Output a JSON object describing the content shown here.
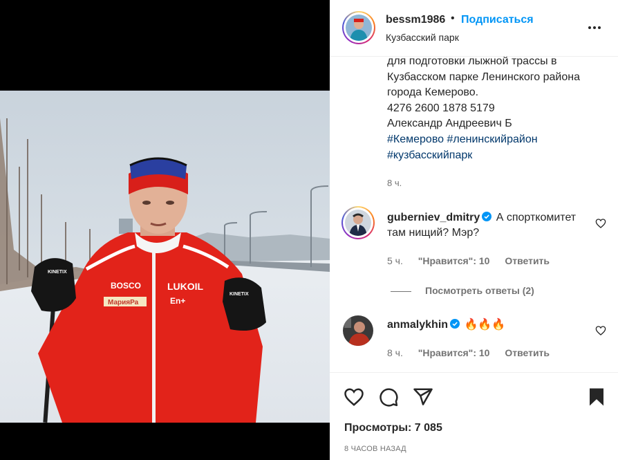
{
  "post": {
    "username": "bessm1986",
    "separator": "•",
    "follow_label": "Подписаться",
    "location": "Кузбасский парк",
    "more_icon": "more-horizontal-icon"
  },
  "caption": {
    "lines": [
      "для подготовки лыжной трассы в",
      "Кузбасском парке Ленинского района",
      "города Кемерово.",
      "4276 2600 1878 5179",
      "Александр Андреевич Б"
    ],
    "hashtags_line1": [
      "#Кемерово",
      "#ленинскийрайон"
    ],
    "hashtags_line2": [
      "#кузбасскийпарк"
    ],
    "time": "8 ч."
  },
  "comments": [
    {
      "username": "guberniev_dmitry",
      "verified": true,
      "text": "А спорткомитет там нищий? Мэр?",
      "time": "5 ч.",
      "likes": "\"Нравится\": 10",
      "reply": "Ответить",
      "view_replies": "Посмотреть ответы (2)"
    },
    {
      "username": "anmalykhin",
      "verified": true,
      "text": "🔥🔥🔥",
      "time": "8 ч.",
      "likes": "\"Нравится\": 10",
      "reply": "Ответить"
    }
  ],
  "actions": {
    "like_icon": "heart-icon",
    "comment_icon": "comment-icon",
    "share_icon": "share-icon",
    "save_icon": "bookmark-icon"
  },
  "stats": {
    "views_label": "Просмотры:",
    "views_value": "7 085",
    "time_ago": "8 ЧАСОВ НАЗАД"
  },
  "video": {
    "jacket_texts": [
      "BOSCO",
      "LUKOIL",
      "МарияРа",
      "Еn+"
    ],
    "pole_brand": "KINETIX"
  },
  "colors": {
    "accent": "#0095f6",
    "hashtag": "#00376b",
    "muted": "#737373",
    "jacket": "#e2231a"
  }
}
